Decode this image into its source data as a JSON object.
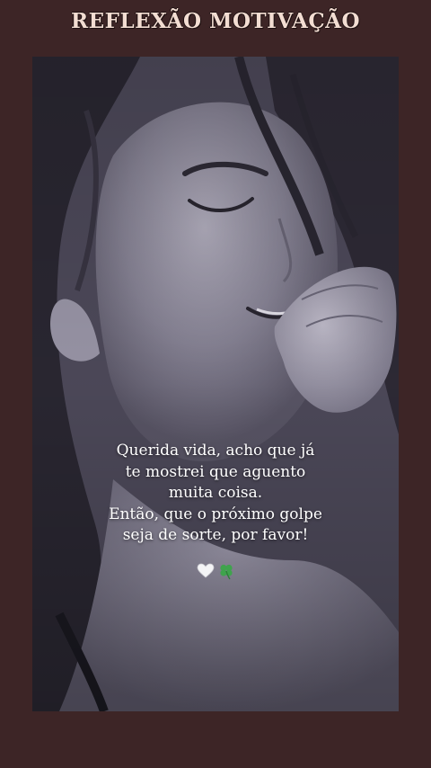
{
  "header": {
    "title": "REFLEXÃO MOTIVAÇÃO"
  },
  "post": {
    "quote_lines": [
      "Querida vida, acho que já",
      "te mostrei que aguento",
      "muita coisa.",
      "Então, que o próximo golpe",
      "seja de sorte, por favor!"
    ],
    "emojis": [
      "white-heart-icon",
      "four-leaf-clover-icon"
    ]
  },
  "colors": {
    "background": "#3d2526",
    "title": "#f3ddd2",
    "quote_text": "#ffffff",
    "photo_tint": "#4a4656"
  }
}
